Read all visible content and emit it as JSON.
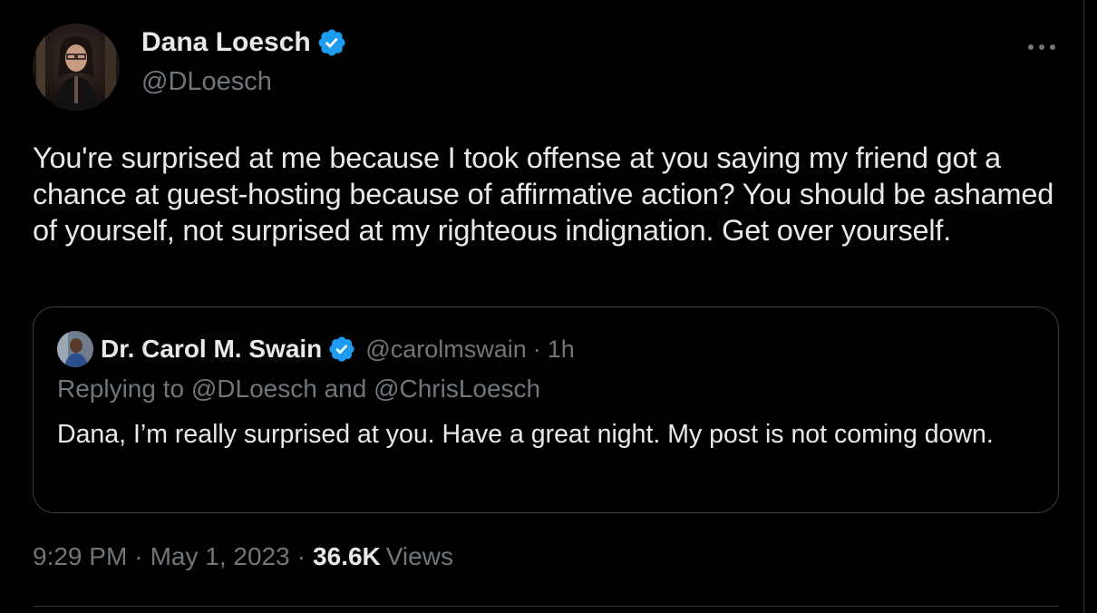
{
  "author": {
    "name": "Dana Loesch",
    "handle": "@DLoesch",
    "verified_icon": "verified-badge-icon",
    "verified_color": "#1d9bf0"
  },
  "tweet": {
    "text": "You're surprised at me because I took offense at you saying my friend got a chance at guest-hosting because of affirmative action? You should be ashamed of yourself, not surprised at my righteous indignation. Get over yourself."
  },
  "quote": {
    "name": "Dr. Carol M. Swain",
    "handle": "@carolmswain",
    "separator": "·",
    "time": "1h",
    "replying_to": "Replying to @DLoesch and @ChrisLoesch",
    "text": "Dana, I’m really surprised at you. Have a great night. My post is not coming down."
  },
  "meta": {
    "time": "9:29 PM",
    "sep1": "·",
    "date": "May 1, 2023",
    "sep2": "·",
    "views_count": "36.6K",
    "views_label": "Views"
  },
  "colors": {
    "background": "#000000",
    "text_primary": "#e7e9ea",
    "text_secondary": "#71767b",
    "border": "#3a3e42"
  },
  "icons": {
    "more": "more-horizontal-icon"
  }
}
